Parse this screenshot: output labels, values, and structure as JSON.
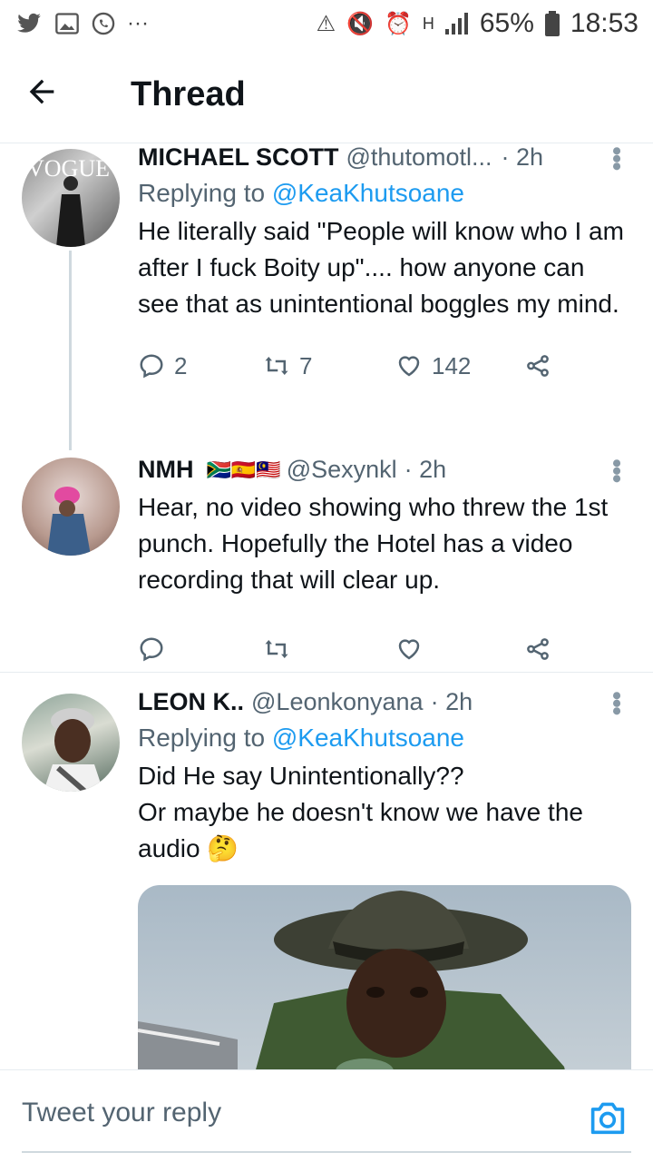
{
  "status_bar": {
    "battery": "65%",
    "time": "18:53",
    "more": "···",
    "network": "H"
  },
  "header": {
    "title": "Thread"
  },
  "tweets": [
    {
      "name": "MICHAEL SCOTT",
      "handle": "@thutomotl...",
      "time": "· 2h",
      "replying_prefix": "Replying to ",
      "replying_to": "@KeaKhutsoane",
      "text": "He literally said \"People will know who I am after I fuck Boity up\".... how anyone can see that as unintentional boggles my mind.",
      "replies": "2",
      "retweets": "7",
      "likes": "142"
    },
    {
      "name": "NMH",
      "flags": "🇿🇦🇪🇸🇲🇾",
      "handle": "@Sexynkl",
      "time": "· 2h",
      "text": "Hear, no video showing who threw the 1st punch. Hopefully the Hotel has a video recording that will clear up."
    },
    {
      "name": "LEON K..",
      "handle": "@Leonkonyana",
      "time": "· 2h",
      "replying_prefix": "Replying to ",
      "replying_to": "@KeaKhutsoane",
      "text_line1": "Did He say Unintentionally??",
      "text_line2": "Or maybe he doesn't know we have the audio 🤔"
    }
  ],
  "reply_bar": {
    "placeholder": "Tweet your reply"
  },
  "colors": {
    "accent": "#1d9bf0",
    "text": "#0f1419",
    "secondary": "#536471"
  }
}
